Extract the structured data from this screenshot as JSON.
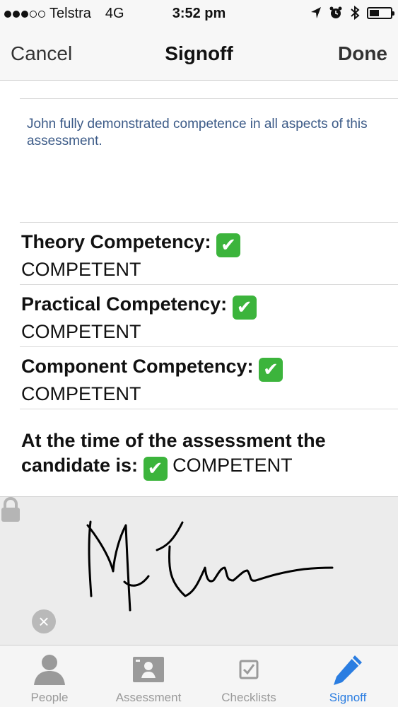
{
  "status_bar": {
    "carrier": "Telstra",
    "network": "4G",
    "time": "3:52 pm",
    "signal_bars_filled": 3,
    "signal_bars_total": 5,
    "battery_level": 0.45
  },
  "nav": {
    "cancel_label": "Cancel",
    "title": "Signoff",
    "done_label": "Done"
  },
  "comment": "John fully demonstrated competence in all aspects of this assessment.",
  "competencies": [
    {
      "label": "Theory Competency:",
      "value": "COMPETENT"
    },
    {
      "label": "Practical Competency:",
      "value": "COMPETENT"
    },
    {
      "label": "Component Competency:",
      "value": "COMPETENT"
    }
  ],
  "overall": {
    "label": "At the time of the assessment the candidate is:",
    "value": "COMPETENT"
  },
  "signature": {
    "clear_icon": "clear-icon",
    "lock_icon": "lock-icon"
  },
  "tabs": [
    {
      "label": "People",
      "icon": "person-icon",
      "active": false
    },
    {
      "label": "Assessment",
      "icon": "assessment-icon",
      "active": false
    },
    {
      "label": "Checklists",
      "icon": "checklist-icon",
      "active": false
    },
    {
      "label": "Signoff",
      "icon": "pencil-icon",
      "active": true
    }
  ],
  "colors": {
    "accent": "#2a7de1",
    "check_green": "#3cb43c",
    "comment_text": "#3b5a87"
  }
}
